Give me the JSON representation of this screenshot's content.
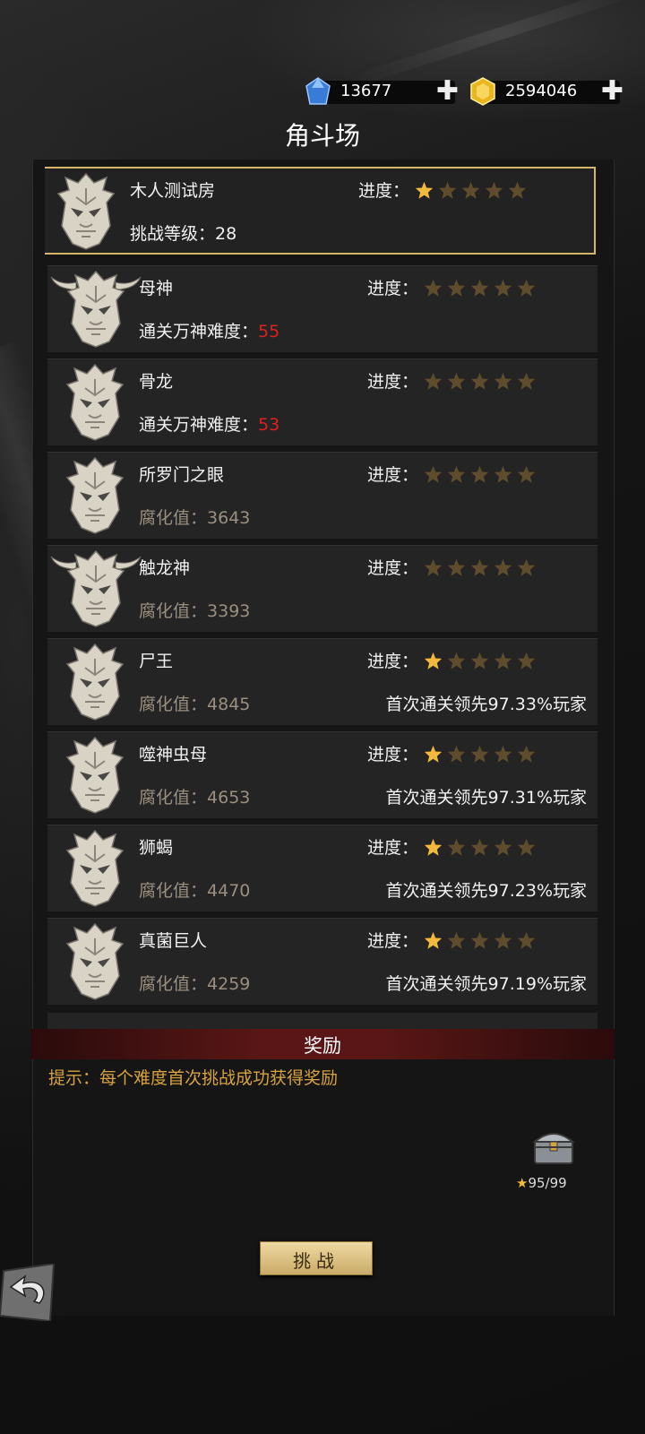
{
  "header": {
    "title": "角斗场",
    "diamonds": "13677",
    "gold": "2594046"
  },
  "progress_label": "进度：",
  "colors": {
    "star_on": "#f3b93a",
    "star_off": "#5e4c2c",
    "accent": "#d4b66b",
    "red": "#e02020"
  },
  "bosses": [
    {
      "name": "木人测试房",
      "sub_label": "挑战等级：",
      "sub_value": "28",
      "stars": 1,
      "total": 5,
      "lead": "",
      "selected": true
    },
    {
      "name": "母神",
      "sub_label": "通关万神难度：",
      "sub_value": "55",
      "stars": 0,
      "total": 5,
      "lead": ""
    },
    {
      "name": "骨龙",
      "sub_label": "通关万神难度：",
      "sub_value": "53",
      "stars": 0,
      "total": 5,
      "lead": ""
    },
    {
      "name": "所罗门之眼",
      "sub_label": "腐化值：",
      "sub_value": "3643",
      "stars": 0,
      "total": 5,
      "lead": ""
    },
    {
      "name": "触龙神",
      "sub_label": "腐化值：",
      "sub_value": "3393",
      "stars": 0,
      "total": 5,
      "lead": ""
    },
    {
      "name": "尸王",
      "sub_label": "腐化值：",
      "sub_value": "4845",
      "stars": 1,
      "total": 5,
      "lead": "首次通关领先97.33%玩家"
    },
    {
      "name": "噬神虫母",
      "sub_label": "腐化值：",
      "sub_value": "4653",
      "stars": 1,
      "total": 5,
      "lead": "首次通关领先97.31%玩家"
    },
    {
      "name": "狮蝎",
      "sub_label": "腐化值：",
      "sub_value": "4470",
      "stars": 1,
      "total": 5,
      "lead": "首次通关领先97.23%玩家"
    },
    {
      "name": "真菌巨人",
      "sub_label": "腐化值：",
      "sub_value": "4259",
      "stars": 1,
      "total": 5,
      "lead": "首次通关领先97.19%玩家"
    }
  ],
  "reward": {
    "title": "奖励",
    "tip": "提示：每个难度首次挑战成功获得奖励",
    "chest_count": "95/99"
  },
  "challenge_button": "挑战"
}
